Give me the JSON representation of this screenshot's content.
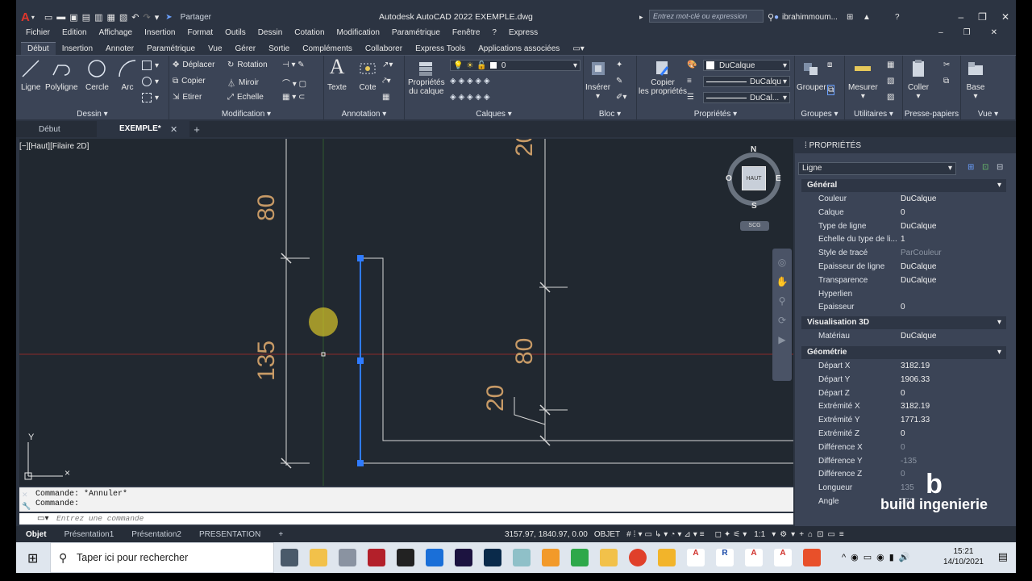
{
  "app": {
    "title": "Autodesk AutoCAD 2022    EXEMPLE.dwg",
    "share_label": "Partager",
    "search_placeholder": "Entrez mot-clé ou expression",
    "user": "ibrahimmoum...",
    "logo": "A"
  },
  "menu": [
    "Fichier",
    "Edition",
    "Affichage",
    "Insertion",
    "Format",
    "Outils",
    "Dessin",
    "Cotation",
    "Modification",
    "Paramétrique",
    "Fenêtre",
    "?",
    "Express"
  ],
  "ribbon_tabs": [
    "Début",
    "Insertion",
    "Annoter",
    "Paramétrique",
    "Vue",
    "Gérer",
    "Sortie",
    "Compléments",
    "Collaborer",
    "Express Tools",
    "Applications associées"
  ],
  "ribbon": {
    "dessin": {
      "label": "Dessin",
      "ligne": "Ligne",
      "polyligne": "Polyligne",
      "cercle": "Cercle",
      "arc": "Arc"
    },
    "modification": {
      "label": "Modification",
      "deplacer": "Déplacer",
      "rotation": "Rotation",
      "copier": "Copier",
      "miroir": "Miroir",
      "etirer": "Etirer",
      "echelle": "Echelle"
    },
    "annotation": {
      "label": "Annotation",
      "texte": "Texte",
      "cote": "Cote"
    },
    "calques": {
      "label": "Calques",
      "proprietes_1": "Propriétés",
      "proprietes_2": "du calque",
      "layer_value": "0"
    },
    "bloc": {
      "label": "Bloc",
      "inserer": "Insérer"
    },
    "proprietes": {
      "label": "Propriétés",
      "copier_1": "Copier",
      "copier_2": "les propriétés",
      "color": "DuCalque",
      "linetype": "DuCalqu",
      "lineweight": "DuCal..."
    },
    "groupes": {
      "label": "Groupes",
      "grouper": "Grouper"
    },
    "utilitaires": {
      "label": "Utilitaires",
      "mesurer": "Mesurer"
    },
    "presse_papiers": {
      "label": "Presse-papiers",
      "coller": "Coller"
    },
    "vue": {
      "label": "Vue",
      "base": "Base"
    }
  },
  "doc_tabs": [
    "Début",
    "EXEMPLE*"
  ],
  "viewport": {
    "label": "[−][Haut][Filaire 2D]",
    "dims": [
      "80",
      "135",
      "20",
      "80",
      "20"
    ],
    "viewcube": {
      "n": "N",
      "s": "S",
      "e": "E",
      "o": "O",
      "face": "HAUT",
      "scu": "SCG"
    },
    "ucs_y": "Y"
  },
  "properties": {
    "header": "PROPRIÉTÉS",
    "object_type": "Ligne",
    "sections": {
      "general": "Général",
      "vis3d": "Visualisation 3D",
      "geometrie": "Géométrie"
    },
    "general_rows": [
      {
        "k": "Couleur",
        "v": "DuCalque"
      },
      {
        "k": "Calque",
        "v": "0"
      },
      {
        "k": "Type de ligne",
        "v": "DuCalque"
      },
      {
        "k": "Echelle du type de li...",
        "v": "1"
      },
      {
        "k": "Style de tracé",
        "v": "ParCouleur"
      },
      {
        "k": "Epaisseur de ligne",
        "v": "DuCalque"
      },
      {
        "k": "Transparence",
        "v": "DuCalque"
      },
      {
        "k": "Hyperlien",
        "v": ""
      },
      {
        "k": "Epaisseur",
        "v": "0"
      }
    ],
    "vis3d_rows": [
      {
        "k": "Matériau",
        "v": "DuCalque"
      }
    ],
    "geom_rows": [
      {
        "k": "Départ X",
        "v": "3182.19"
      },
      {
        "k": "Départ Y",
        "v": "1906.33"
      },
      {
        "k": "Départ Z",
        "v": "0"
      },
      {
        "k": "Extrémité X",
        "v": "3182.19"
      },
      {
        "k": "Extrémité Y",
        "v": "1771.33"
      },
      {
        "k": "Extrémité Z",
        "v": "0"
      },
      {
        "k": "Différence X",
        "v": "0"
      },
      {
        "k": "Différence Y",
        "v": "-135"
      },
      {
        "k": "Différence Z",
        "v": "0"
      },
      {
        "k": "Longueur",
        "v": "135"
      },
      {
        "k": "Angle",
        "v": "270"
      }
    ]
  },
  "command": {
    "line1": "Commande: *Annuler*",
    "line2": "Commande:",
    "placeholder": "Entrez une commande"
  },
  "layout_tabs": [
    "Objet",
    "Présentation1",
    "Présentation2",
    "PRESENTATION"
  ],
  "status": {
    "coords": "3157.97, 1840.97, 0.00",
    "mode": "OBJET",
    "scale": "1:1"
  },
  "taskbar": {
    "search_placeholder": "Taper ici pour rechercher",
    "time": "15:21",
    "date": "14/10/2021"
  },
  "watermark": "build ingenierie",
  "colors": {
    "dim_text": "#c79a66",
    "selection": "#2f7bff",
    "axis_red": "#8a2a2a",
    "axis_green": "#2e5a2e",
    "bg": "#212830"
  }
}
